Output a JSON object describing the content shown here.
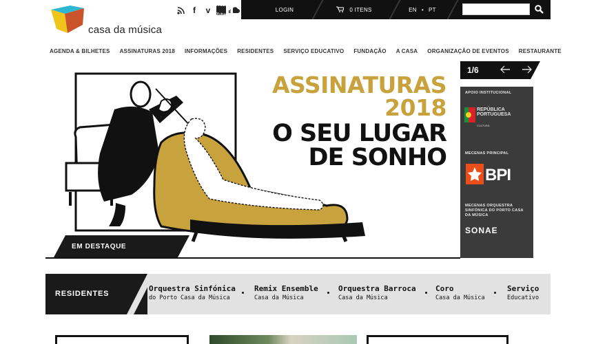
{
  "brand": {
    "name": "casa da música"
  },
  "social": [
    {
      "name": "rss",
      "label": ""
    },
    {
      "name": "facebook",
      "label": "f"
    },
    {
      "name": "vimeo",
      "label": "v"
    },
    {
      "name": "youtube",
      "label": "You Tube"
    },
    {
      "name": "soundcloud",
      "label": ""
    }
  ],
  "topbar": {
    "login": "LOGIN",
    "cart": "0 ITENS",
    "lang_en": "EN",
    "lang_sep": "•",
    "lang_pt": "PT",
    "search_placeholder": ""
  },
  "nav": [
    "AGENDA & BILHETES",
    "ASSINATURAS 2018",
    "INFORMAÇÕES",
    "RESIDENTES",
    "SERVIÇO EDUCATIVO",
    "FUNDAÇÃO",
    "A CASA",
    "ORGANIZAÇÃO DE EVENTOS",
    "RESTAURANTE"
  ],
  "hero": {
    "line1": "ASSINATURAS",
    "line2": "2018",
    "line3": "O SEU LUGAR",
    "line4": "DE SONHO",
    "feature_label": "EM DESTAQUE"
  },
  "slider": {
    "position": "1/6"
  },
  "sponsors": {
    "institutional_label": "APOIO INSTITUCIONAL",
    "republica_1": "REPÚBLICA",
    "republica_2": "PORTUGUESA",
    "republica_3": "CULTURA",
    "main_label": "MECENAS PRINCIPAL",
    "main_name": "BPI",
    "orchestra_label": "MECENAS ORQUESTRA SINFÓNICA DO PORTO CASA DA MÚSICA",
    "orchestra_name": "SONAE"
  },
  "residents": {
    "label": "RESIDENTES",
    "items": [
      {
        "title": "Orquestra Sinfónica",
        "subtitle": "do Porto Casa da Música"
      },
      {
        "title": "Remix Ensemble",
        "subtitle": "Casa da Música"
      },
      {
        "title": "Orquestra Barroca",
        "subtitle": "Casa da Música"
      },
      {
        "title": "Coro",
        "subtitle": "Casa da Música"
      },
      {
        "title": "Serviço",
        "subtitle": "Educativo"
      }
    ]
  },
  "colors": {
    "gold": "#c7a23d",
    "dark": "#111111",
    "gray": "#3b3b3b",
    "residents_bg": "#e2e2e2"
  }
}
